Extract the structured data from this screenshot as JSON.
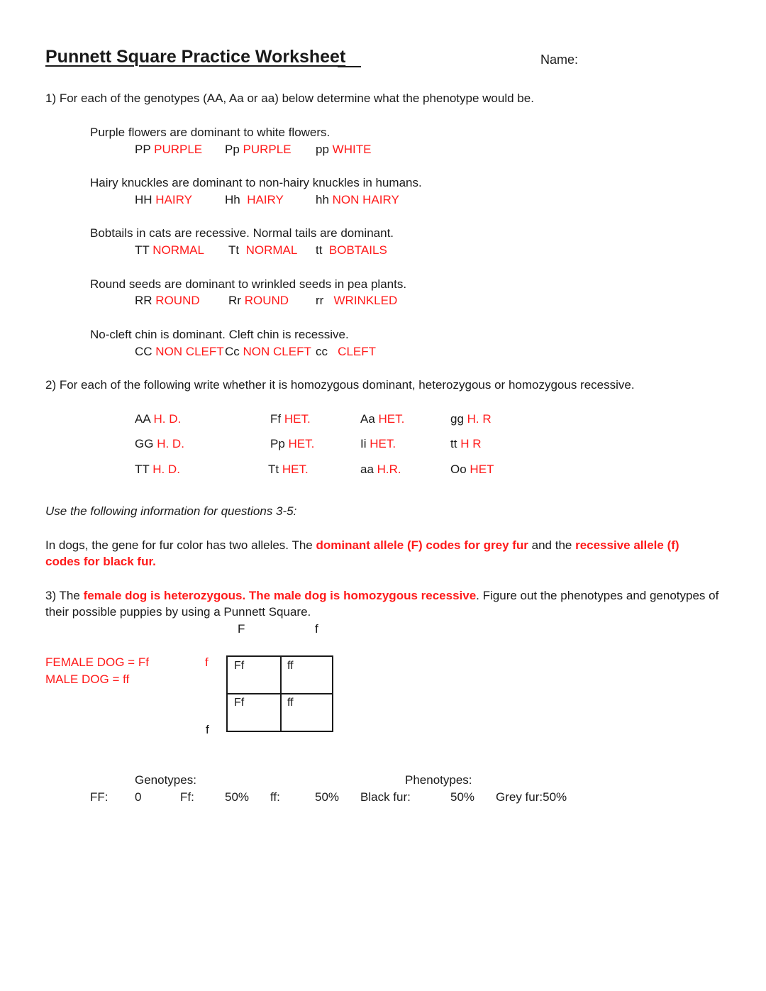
{
  "header": {
    "title": "Punnett Square Practice Worksheet",
    "name_label": "Name:"
  },
  "q1": {
    "prompt": "1) For each of the genotypes (AA, Aa or aa) below determine what the phenotype would be.",
    "traits": [
      {
        "statement": "Purple flowers are dominant to white flowers.",
        "answers": [
          {
            "genotype": "PP",
            "phenotype": "PURPLE"
          },
          {
            "genotype": "Pp",
            "phenotype": "PURPLE"
          },
          {
            "genotype": "pp",
            "phenotype": "WHITE"
          }
        ]
      },
      {
        "statement": "Hairy knuckles are dominant to non-hairy knuckles in humans.",
        "answers": [
          {
            "genotype": "HH",
            "phenotype": "HAIRY"
          },
          {
            "genotype": "Hh",
            "phenotype": "HAIRY"
          },
          {
            "genotype": "hh",
            "phenotype": "NON HAIRY"
          }
        ]
      },
      {
        "statement": "Bobtails in cats are recessive. Normal tails are dominant.",
        "answers": [
          {
            "genotype": "TT",
            "phenotype": "NORMAL"
          },
          {
            "genotype": "Tt",
            "phenotype": "NORMAL"
          },
          {
            "genotype": "tt",
            "phenotype": "BOBTAILS"
          }
        ]
      },
      {
        "statement": "Round seeds are dominant to wrinkled seeds in pea plants.",
        "answers": [
          {
            "genotype": "RR",
            "phenotype": "ROUND"
          },
          {
            "genotype": "Rr",
            "phenotype": "ROUND"
          },
          {
            "genotype": "rr",
            "phenotype": "WRINKLED"
          }
        ]
      },
      {
        "statement": "No-cleft chin is dominant. Cleft chin is recessive.",
        "answers": [
          {
            "genotype": "CC",
            "phenotype": "NON CLEFT"
          },
          {
            "genotype": "Cc",
            "phenotype": "NON CLEFT"
          },
          {
            "genotype": "cc",
            "phenotype": "CLEFT"
          }
        ]
      }
    ]
  },
  "q2": {
    "prompt": "2) For each of the following write whether it is homozygous dominant, heterozygous or homozygous recessive.",
    "rows": [
      [
        {
          "genotype": "AA",
          "answer": "H. D."
        },
        {
          "genotype": "Ff",
          "answer": "HET."
        },
        {
          "genotype": "Aa",
          "answer": "HET."
        },
        {
          "genotype": "gg",
          "answer": "H. R"
        }
      ],
      [
        {
          "genotype": "GG",
          "answer": "H. D."
        },
        {
          "genotype": "Pp",
          "answer": "HET."
        },
        {
          "genotype": "Ii",
          "answer": "HET."
        },
        {
          "genotype": "tt",
          "answer": "H R"
        }
      ],
      [
        {
          "genotype": "TT",
          "answer": "H. D."
        },
        {
          "genotype": "Tt",
          "answer": "HET."
        },
        {
          "genotype": "aa",
          "answer": "H.R."
        },
        {
          "genotype": "Oo",
          "answer": "HET"
        }
      ]
    ]
  },
  "info": {
    "instruction": "Use the following information for questions 3-5:",
    "intro_plain1": "In dogs, the gene for fur color has two alleles.  The ",
    "intro_red1": "dominant allele (F) codes for grey fur",
    "intro_plain2": " and the ",
    "intro_red2": "recessive allele (f)",
    "intro_red3": "codes for black fur."
  },
  "q3": {
    "prefix": "3) The ",
    "red": "female dog is heterozygous. The male dog is homozygous recessive",
    "suffix": ". Figure out the phenotypes and genotypes of",
    "line2": "their possible puppies by using a Punnett Square.",
    "top_alleles": [
      "F",
      "f"
    ],
    "side_alleles": [
      "f",
      "f"
    ],
    "female": "FEMALE DOG = Ff",
    "male": "MALE DOG = ff",
    "cells": [
      [
        "Ff",
        "ff"
      ],
      [
        "Ff",
        "ff"
      ]
    ],
    "genotypes_label": "Genotypes:",
    "phenotypes_label": "Phenotypes:",
    "results": {
      "FF_label": "FF:",
      "FF_value": "0",
      "Ff_label": "Ff:",
      "Ff_value": "50%",
      "ff_label": "ff:",
      "ff_value": "50%",
      "black_label": "Black fur:",
      "black_value": "50%",
      "grey": "Grey fur:50%"
    }
  }
}
